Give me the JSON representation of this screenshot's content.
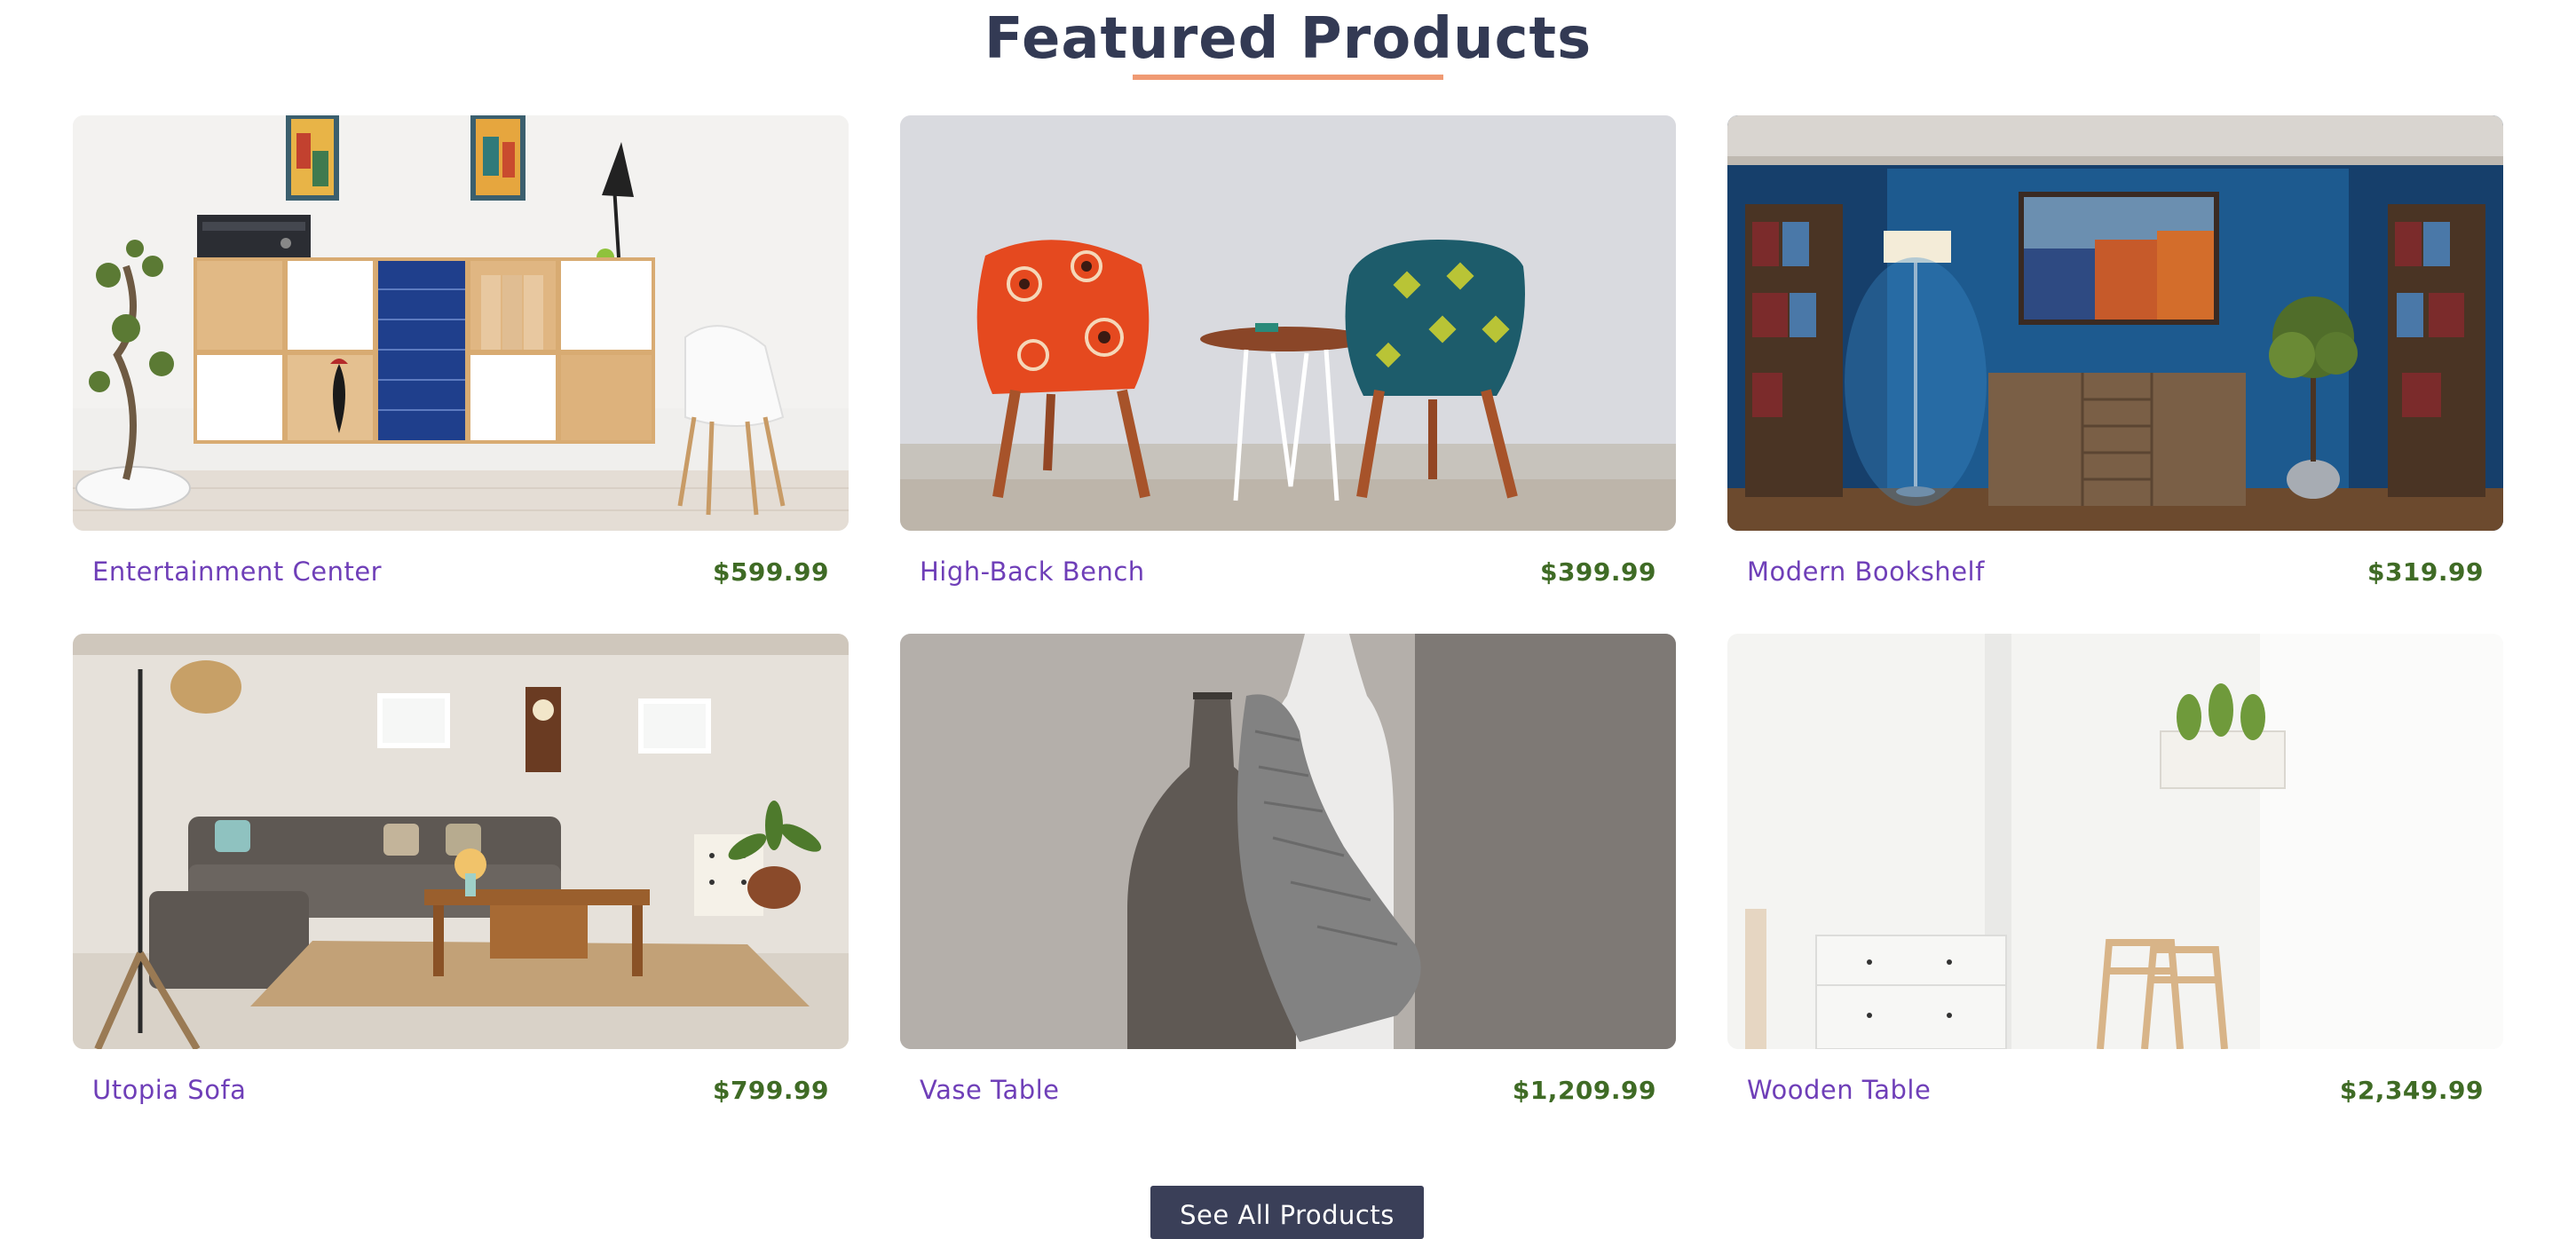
{
  "section": {
    "title": "Featured Products",
    "accent_color": "#f09a73",
    "button_label": "See All Products"
  },
  "products": [
    {
      "name": "Entertainment Center",
      "price": "$599.99",
      "image": "white-shelving-unit-with-blue-drawers-and-white-chair"
    },
    {
      "name": "High-Back Bench",
      "price": "$399.99",
      "image": "two-patterned-armchairs-with-side-table"
    },
    {
      "name": "Modern Bookshelf",
      "price": "$319.99",
      "image": "blue-room-with-bookshelves-lamp-and-dresser"
    },
    {
      "name": "Utopia Sofa",
      "price": "$799.99",
      "image": "living-room-with-grey-sectional-sofa"
    },
    {
      "name": "Vase Table",
      "price": "$1,209.99",
      "image": "grey-vases-with-knitted-scarf"
    },
    {
      "name": "Wooden Table",
      "price": "$2,349.99",
      "image": "white-room-with-dresser-and-wooden-chairs"
    }
  ],
  "colors": {
    "title": "#333a54",
    "product_name": "#6f3fb8",
    "price": "#3f6b25",
    "button_bg": "#3a3f58"
  }
}
